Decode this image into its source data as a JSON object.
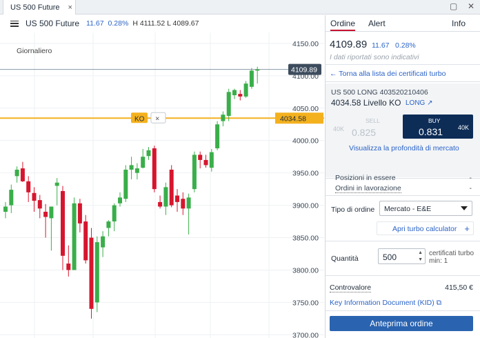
{
  "window": {
    "tab_title": "US 500 Future",
    "tab_close": "×",
    "restore_icon": "▢",
    "close_icon": "✕"
  },
  "chart_header": {
    "instrument": "US 500 Future",
    "change": "11.67",
    "change_pct": "0.28%",
    "high_low": "H 4111.52 L 4089.67"
  },
  "chart": {
    "timeframe": "Giornaliero",
    "ko_label": "KO",
    "ko_close": "×",
    "current_price_label": "4109.89",
    "ko_price_label": "4034.58",
    "colors": {
      "up": "#3aae4a",
      "down": "#d6162e",
      "ko": "#f4b11e",
      "price_tag": "#3d4c5d"
    }
  },
  "chart_data": {
    "type": "candlestick",
    "y_ticks": [
      "4150.00",
      "4100.00",
      "4050.00",
      "4000.00",
      "3950.00",
      "3900.00",
      "3850.00",
      "3800.00",
      "3750.00",
      "3700.00"
    ],
    "ylim": [
      3695,
      4167
    ],
    "current_price": 4109.89,
    "ko_level": 4034.58,
    "candles": [
      {
        "o": 3890,
        "h": 3905,
        "l": 3880,
        "c": 3898
      },
      {
        "o": 3900,
        "h": 3932,
        "l": 3888,
        "c": 3924
      },
      {
        "o": 3945,
        "h": 3960,
        "l": 3935,
        "c": 3955
      },
      {
        "o": 3957,
        "h": 3967,
        "l": 3936,
        "c": 3937
      },
      {
        "o": 3937,
        "h": 3945,
        "l": 3905,
        "c": 3920
      },
      {
        "o": 3919,
        "h": 3928,
        "l": 3890,
        "c": 3907
      },
      {
        "o": 3908,
        "h": 3916,
        "l": 3880,
        "c": 3895
      },
      {
        "o": 3890,
        "h": 3902,
        "l": 3850,
        "c": 3882
      },
      {
        "o": 3880,
        "h": 3898,
        "l": 3830,
        "c": 3898
      },
      {
        "o": 3930,
        "h": 3942,
        "l": 3900,
        "c": 3935
      },
      {
        "o": 3922,
        "h": 3930,
        "l": 3800,
        "c": 3822
      },
      {
        "o": 3810,
        "h": 3838,
        "l": 3790,
        "c": 3800
      },
      {
        "o": 3800,
        "h": 3912,
        "l": 3800,
        "c": 3903
      },
      {
        "o": 3903,
        "h": 3910,
        "l": 3858,
        "c": 3872
      },
      {
        "o": 3875,
        "h": 3885,
        "l": 3810,
        "c": 3815
      },
      {
        "o": 3850,
        "h": 3865,
        "l": 3725,
        "c": 3740
      },
      {
        "o": 3750,
        "h": 3852,
        "l": 3735,
        "c": 3843
      },
      {
        "o": 3835,
        "h": 3860,
        "l": 3820,
        "c": 3852
      },
      {
        "o": 3865,
        "h": 3877,
        "l": 3852,
        "c": 3875
      },
      {
        "o": 3875,
        "h": 3903,
        "l": 3860,
        "c": 3900
      },
      {
        "o": 3903,
        "h": 3920,
        "l": 3898,
        "c": 3912
      },
      {
        "o": 3910,
        "h": 3962,
        "l": 3905,
        "c": 3955
      },
      {
        "o": 3955,
        "h": 3975,
        "l": 3940,
        "c": 3962
      },
      {
        "o": 3950,
        "h": 3965,
        "l": 3940,
        "c": 3957
      },
      {
        "o": 3958,
        "h": 3987,
        "l": 3957,
        "c": 3975
      },
      {
        "o": 3976,
        "h": 3990,
        "l": 3970,
        "c": 3985
      },
      {
        "o": 3988,
        "h": 3992,
        "l": 3920,
        "c": 3925
      },
      {
        "o": 3905,
        "h": 3915,
        "l": 3895,
        "c": 3898
      },
      {
        "o": 3898,
        "h": 3935,
        "l": 3885,
        "c": 3928
      },
      {
        "o": 3955,
        "h": 3962,
        "l": 3897,
        "c": 3900
      },
      {
        "o": 3915,
        "h": 3925,
        "l": 3890,
        "c": 3905
      },
      {
        "o": 3910,
        "h": 3920,
        "l": 3885,
        "c": 3895
      },
      {
        "o": 3895,
        "h": 3918,
        "l": 3855,
        "c": 3912
      },
      {
        "o": 3925,
        "h": 3983,
        "l": 3920,
        "c": 3978
      },
      {
        "o": 3978,
        "h": 3983,
        "l": 3957,
        "c": 3970
      },
      {
        "o": 3970,
        "h": 3978,
        "l": 3958,
        "c": 3962
      },
      {
        "o": 3958,
        "h": 3987,
        "l": 3952,
        "c": 3982
      },
      {
        "o": 3988,
        "h": 4030,
        "l": 3985,
        "c": 4025
      },
      {
        "o": 4030,
        "h": 4045,
        "l": 4022,
        "c": 4040
      },
      {
        "o": 4038,
        "h": 4080,
        "l": 4030,
        "c": 4075
      },
      {
        "o": 4070,
        "h": 4080,
        "l": 4064,
        "c": 4078
      },
      {
        "o": 4072,
        "h": 4078,
        "l": 4062,
        "c": 4068
      },
      {
        "o": 4068,
        "h": 4092,
        "l": 4066,
        "c": 4088
      },
      {
        "o": 4083,
        "h": 4112,
        "l": 4080,
        "c": 4108
      },
      {
        "o": 4108,
        "h": 4114,
        "l": 4088,
        "c": 4110
      }
    ]
  },
  "panel": {
    "tab_order": "Ordine",
    "tab_alert": "Alert",
    "tab_info": "Info",
    "price": "4109.89",
    "change": "11.67",
    "change_pct": "0.28%",
    "indicative_note": "I dati riportati sono indicativi",
    "back_link": "Torna alla lista dei certificati turbo",
    "cert_code": "US 500 LONG 403520210406",
    "cert_level": "4034.58 Livello KO",
    "cert_dir": "LONG",
    "sell_label": "SELL",
    "sell_value": "0.825",
    "sell_size": "40K",
    "buy_label": "BUY",
    "buy_value": "0.831",
    "buy_size": "40K",
    "depth_link": "Visualizza la profondità di mercato",
    "positions_label": "Posizioni in essere",
    "positions_value": "-",
    "orders_label": "Ordini in lavorazione",
    "orders_value": "-",
    "order_type_label": "Tipo di ordine",
    "order_type_value": "Mercato - E&E",
    "calc_link": "Apri turbo calculator",
    "calc_plus": "+",
    "qty_label": "Quantità",
    "qty_value": "500",
    "qty_note1": "certificati turbo",
    "qty_note2": "min: 1",
    "ctrv_label": "Controvalore",
    "ctrv_value": "415,50 €",
    "kid_link": "Key Information Document (KID)",
    "preview_button": "Anteprima ordine"
  }
}
